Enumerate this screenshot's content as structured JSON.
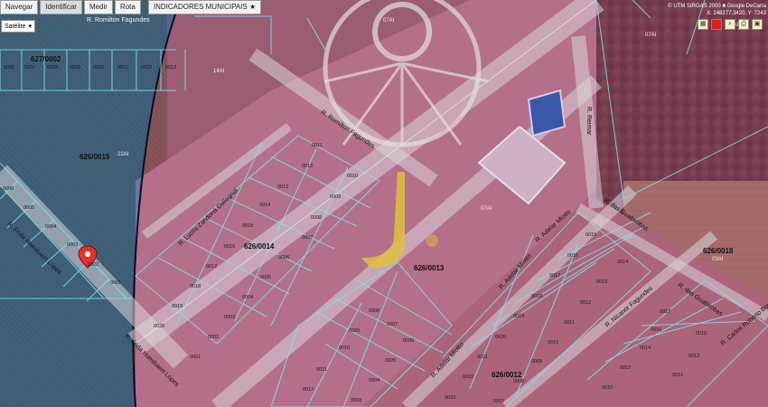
{
  "toolbar": {
    "navigate": "Navegar",
    "identify": "Identificar",
    "measure": "Medir",
    "route": "Rota",
    "indicators": "INDICADORES MUNICIPAIS"
  },
  "layer_select": {
    "value": "Satélite"
  },
  "coords": {
    "line1": "© UTM SIRGAS 2000 ■ Google DeCarta",
    "line2": "X: 248277.3420, Y: 7243"
  },
  "tool_icons": [
    "chart-icon",
    "red-square-icon",
    "magnifier-icon",
    "print-icon",
    "lock-icon"
  ],
  "streets": {
    "romilton_top": "R. Romilton Fagundes",
    "romilton_mid": "R. Romilton Fagundes",
    "reimar": "R. Reimar",
    "zandona": "R. Lucila Zandoná Dallagnol",
    "frida": "R. Frida Haesbaert Lopes",
    "frida_bottom": "R. Frida Haesbaert Lopes",
    "adelar_top": "R. Adelar Miotto",
    "adelar_mid": "R. Adelar Miotto",
    "adelar_bottom": "R. Adelar Miotto",
    "guabirobas": "R. das Guabirobas",
    "nicanor": "R. Nicanor Fagundes",
    "guabirobas_2": "R. das Guabirobas",
    "roberto": "R. Carlos Roberto Bonfim"
  },
  "zones": {
    "z1": "07AI",
    "z2": "07AI",
    "z3": "07AI",
    "z4": "22AI",
    "z5": "22AI",
    "z6": "03AI",
    "z7": "14AI"
  },
  "blocks": {
    "b627_0002": "627/0002",
    "b626_0015": "626/0015",
    "b626_0014": "626/0014",
    "b626_0013": "626/0013",
    "b626_0012": "626/0012",
    "b626_0018": "626/0018"
  },
  "lots": {
    "top_row": [
      "0006",
      "0007",
      "0008",
      "0009",
      "0010",
      "0011",
      "0012",
      "0013"
    ],
    "left_strip": [
      "0006",
      "0005",
      "0004",
      "0003",
      "0002",
      "0001"
    ],
    "block14": [
      "0011",
      "0012",
      "0010",
      "0013",
      "0009",
      "0014",
      "0008",
      "0015",
      "0007",
      "0016",
      "0006",
      "0017",
      "0005",
      "0018",
      "0004",
      "0019",
      "0003",
      "0020",
      "0002",
      "0001"
    ],
    "block13": [
      "0008",
      "0007",
      "0009",
      "0006",
      "0010",
      "0005",
      "0011",
      "0004",
      "0012",
      "0003"
    ],
    "block12": [
      "0015",
      "0014",
      "0016",
      "0013",
      "0017",
      "0012",
      "0018",
      "0011",
      "0019",
      "0010",
      "0020",
      "0009",
      "0021",
      "0008",
      "0022",
      "0007",
      "0023",
      "0006"
    ],
    "right_block": [
      "0017",
      "0016",
      "0015",
      "0014",
      "0013",
      "0012",
      "0011",
      "0010"
    ]
  }
}
